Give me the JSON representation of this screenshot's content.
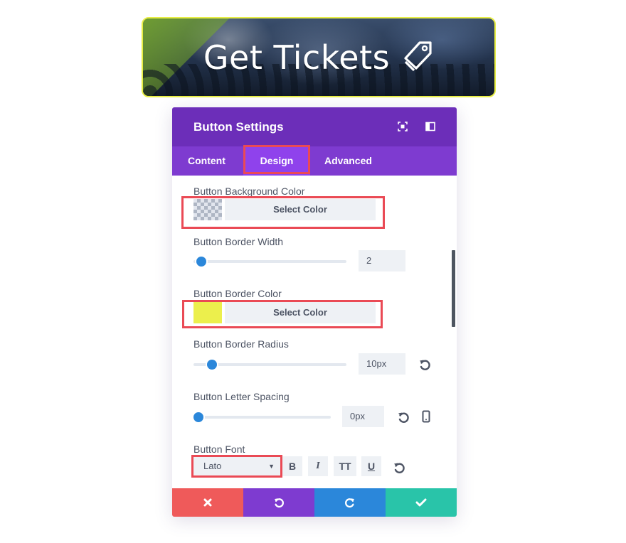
{
  "preview": {
    "label": "Get Tickets",
    "icon": "tag-icon",
    "border_color": "#e8ee45"
  },
  "panel": {
    "title": "Button Settings",
    "header_icons": [
      "expand-icon",
      "sidebar-icon"
    ],
    "tabs": [
      {
        "label": "Content",
        "active": false
      },
      {
        "label": "Design",
        "active": true
      },
      {
        "label": "Advanced",
        "active": false
      }
    ]
  },
  "settings": {
    "bg_color": {
      "label": "Button Background Color",
      "button": "Select Color"
    },
    "border_width": {
      "label": "Button Border Width",
      "value": "2"
    },
    "border_color": {
      "label": "Button Border Color",
      "button": "Select Color",
      "swatch": "#ecef4c"
    },
    "border_radius": {
      "label": "Button Border Radius",
      "value": "10px"
    },
    "letter_spacing": {
      "label": "Button Letter Spacing",
      "value": "0px"
    },
    "font": {
      "label": "Button Font",
      "value": "Lato",
      "bold": "B",
      "italic": "I",
      "uppercase": "TT",
      "underline": "U"
    }
  },
  "footer": {
    "colors": {
      "discard": "#ef5a5a",
      "undo": "#7e3bd0",
      "redo": "#2b87da",
      "save": "#29c4a9"
    }
  },
  "colors": {
    "header": "#6c2eb9",
    "tabs": "#7e3bd0",
    "active_tab": "#8f42ec",
    "highlight": "#ea4a55",
    "accent": "#2b87da"
  }
}
